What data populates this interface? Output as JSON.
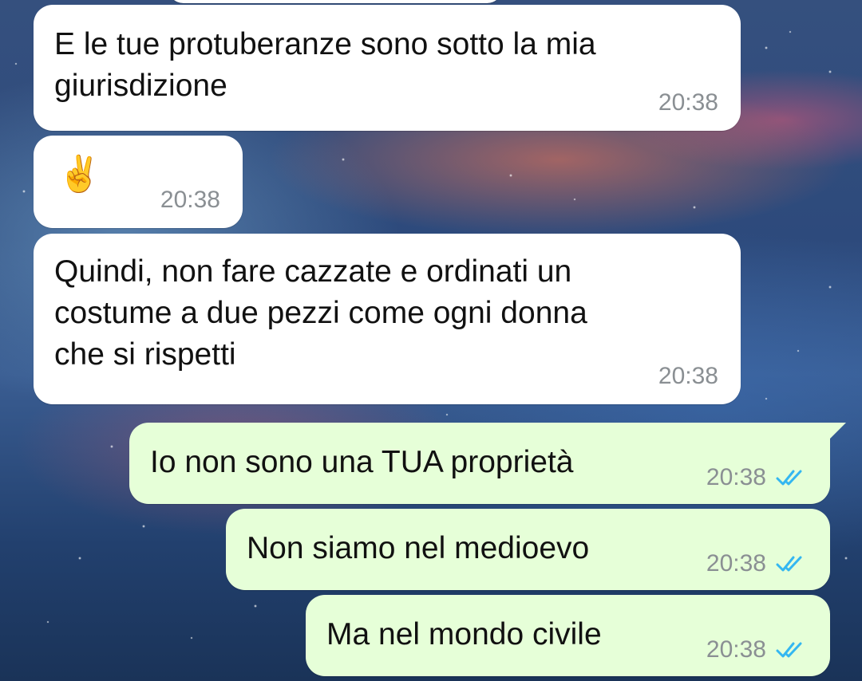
{
  "messages": [
    {
      "direction": "incoming",
      "text": "E le tue protuberanze sono sotto la mia\ngiurisdizione",
      "time": "20:38"
    },
    {
      "direction": "incoming",
      "text": "✌️",
      "time": "20:38"
    },
    {
      "direction": "incoming",
      "text": "Quindi, non fare cazzate e ordinati un\ncostume a due pezzi come ogni donna\nche si rispetti",
      "time": "20:38"
    },
    {
      "direction": "outgoing",
      "text": "Io non sono una TUA proprietà",
      "time": "20:38",
      "status_icon": "double-check-read-icon"
    },
    {
      "direction": "outgoing",
      "text": "Non siamo nel medioevo",
      "time": "20:38",
      "status_icon": "double-check-read-icon"
    },
    {
      "direction": "outgoing",
      "text": "Ma nel mondo civile",
      "time": "20:38",
      "status_icon": "double-check-read-icon"
    }
  ],
  "colors": {
    "incoming_bubble": "#ffffff",
    "outgoing_bubble": "#e6ffd8",
    "timestamp": "#8a8f93",
    "read_ticks": "#34b7f1"
  }
}
